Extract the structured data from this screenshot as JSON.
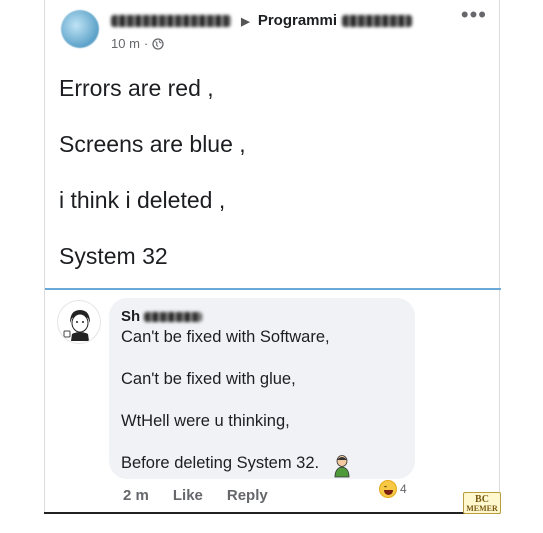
{
  "post": {
    "group": "Programmi",
    "time": "10 m",
    "lines": [
      "Errors are red ,",
      "Screens are blue ,",
      "i think i deleted ,",
      "System 32"
    ]
  },
  "comment": {
    "author": "Sh",
    "lines": [
      "Can't be fixed with Software,",
      "Can't be fixed with glue,",
      "WtHell were u thinking,",
      "Before deleting System 32."
    ],
    "reaction_count": "4",
    "time": "2 m",
    "like_label": "Like",
    "reply_label": "Reply"
  },
  "watermark": {
    "line1": "BC",
    "line2": "MEMER"
  },
  "icons": {
    "globe": "globe-icon",
    "more": "more-options-icon",
    "arrow": "triangle-right-icon",
    "haha": "haha-reaction-icon",
    "sticker": "person-sticker-icon"
  },
  "colors": {
    "divider": "#6aa8d8",
    "meta": "#65676b",
    "bubble": "#f0f2f5",
    "text": "#1c1e21"
  }
}
